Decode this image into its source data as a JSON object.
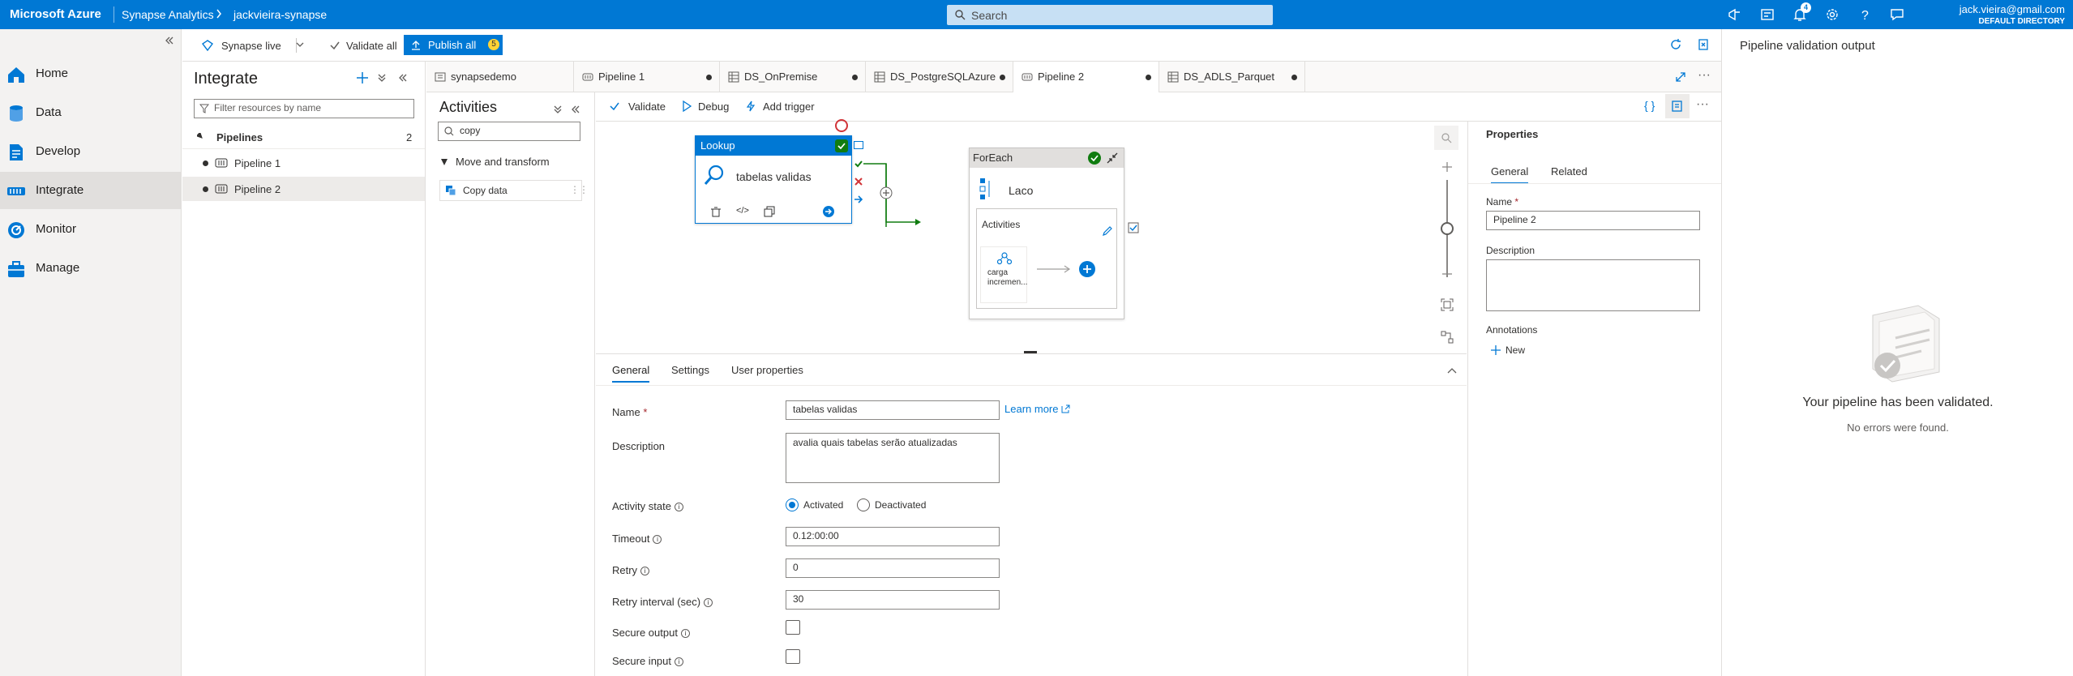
{
  "topbar": {
    "brand": "Microsoft Azure",
    "service": "Synapse Analytics",
    "workspace": "jackvieira-synapse",
    "search_placeholder": "Search",
    "notification_count": "4",
    "user_email": "jack.vieira@gmail.com",
    "user_directory": "DEFAULT DIRECTORY"
  },
  "leftnav": {
    "items": [
      {
        "label": "Home",
        "icon": "home-icon"
      },
      {
        "label": "Data",
        "icon": "database-icon"
      },
      {
        "label": "Develop",
        "icon": "document-icon"
      },
      {
        "label": "Integrate",
        "icon": "pipeline-icon"
      },
      {
        "label": "Monitor",
        "icon": "monitor-icon"
      },
      {
        "label": "Manage",
        "icon": "toolbox-icon"
      }
    ],
    "active": "Integrate"
  },
  "subbar": {
    "synapse_live": "Synapse live",
    "validate_all": "Validate all",
    "publish_all": "Publish all",
    "publish_count": "5"
  },
  "integrate": {
    "title": "Integrate",
    "filter_placeholder": "Filter resources by name",
    "group": "Pipelines",
    "group_count": "2",
    "pipelines": [
      "Pipeline 1",
      "Pipeline 2"
    ]
  },
  "activities": {
    "title": "Activities",
    "search_value": "copy",
    "category": "Move and transform",
    "item": "Copy data"
  },
  "tabs": [
    {
      "label": "synapsedemo",
      "dirty": false
    },
    {
      "label": "Pipeline 1",
      "dirty": true
    },
    {
      "label": "DS_OnPremise",
      "dirty": true
    },
    {
      "label": "DS_PostgreSQLAzure",
      "dirty": true
    },
    {
      "label": "Pipeline 2",
      "dirty": true
    },
    {
      "label": "DS_ADLS_Parquet",
      "dirty": true
    }
  ],
  "canvas_toolbar": {
    "validate": "Validate",
    "debug": "Debug",
    "add_trigger": "Add trigger"
  },
  "canvas": {
    "lookup": {
      "header": "Lookup",
      "name": "tabelas validas"
    },
    "foreach": {
      "header": "ForEach",
      "name": "Laco",
      "inner_title": "Activities",
      "inner_activity": "carga incremen..."
    }
  },
  "bottom": {
    "tabs": [
      "General",
      "Settings",
      "User properties"
    ],
    "active_tab": "General",
    "name_label": "Name",
    "name_value": "tabelas validas",
    "learn_more": "Learn more",
    "description_label": "Description",
    "description_value": "avalia quais tabelas serão atualizadas",
    "activity_state_label": "Activity state",
    "activated": "Activated",
    "deactivated": "Deactivated",
    "timeout_label": "Timeout",
    "timeout_value": "0.12:00:00",
    "retry_label": "Retry",
    "retry_value": "0",
    "retry_interval_label": "Retry interval (sec)",
    "retry_interval_value": "30",
    "secure_output_label": "Secure output",
    "secure_input_label": "Secure input"
  },
  "properties": {
    "title": "Properties",
    "tabs": [
      "General",
      "Related"
    ],
    "name_label": "Name",
    "name_value": "Pipeline 2",
    "description_label": "Description",
    "annotations_label": "Annotations",
    "new_label": "New"
  },
  "validation": {
    "title": "Pipeline validation output",
    "message": "Your pipeline has been validated.",
    "sub": "No errors were found."
  },
  "colors": {
    "accent": "#0078d4",
    "success": "#107c10",
    "error": "#d13438"
  }
}
